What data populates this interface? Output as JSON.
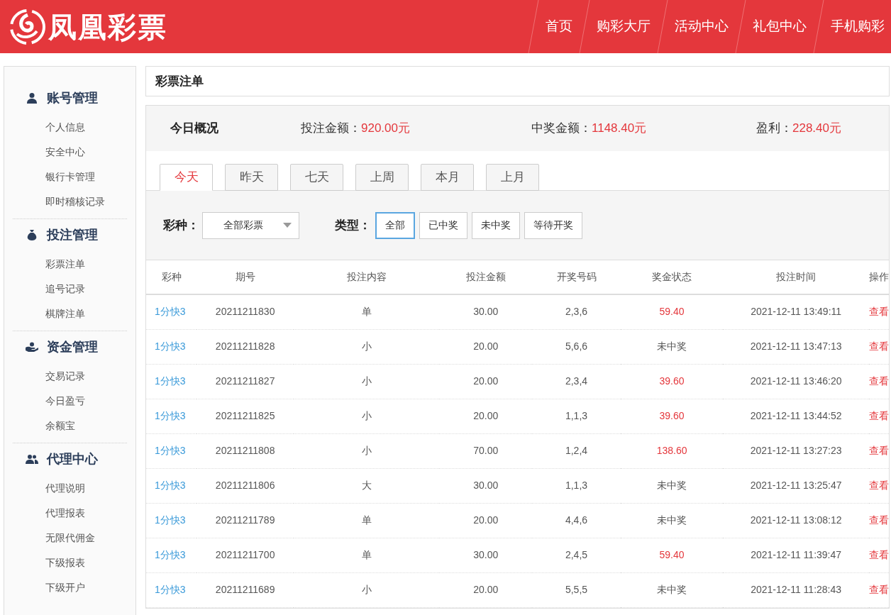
{
  "header": {
    "logo_text": "凤凰彩票",
    "nav": [
      "首页",
      "购彩大厅",
      "活动中心",
      "礼包中心",
      "手机购彩"
    ]
  },
  "sidebar": [
    {
      "title": "账号管理",
      "items": [
        "个人信息",
        "安全中心",
        "银行卡管理",
        "即时稽核记录"
      ]
    },
    {
      "title": "投注管理",
      "items": [
        "彩票注单",
        "追号记录",
        "棋牌注单"
      ]
    },
    {
      "title": "资金管理",
      "items": [
        "交易记录",
        "今日盈亏",
        "余额宝"
      ]
    },
    {
      "title": "代理中心",
      "items": [
        "代理说明",
        "代理报表",
        "无限代佣金",
        "下级报表",
        "下级开户"
      ]
    }
  ],
  "page_title": "彩票注单",
  "summary": {
    "title": "今日概况",
    "stats": [
      {
        "label": "投注金额：",
        "value": "920.00元"
      },
      {
        "label": "中奖金额：",
        "value": "1148.40元"
      },
      {
        "label": "盈利：",
        "value": "228.40元"
      }
    ]
  },
  "tabs": [
    {
      "label": "今天",
      "selected": true
    },
    {
      "label": "昨天",
      "selected": false
    },
    {
      "label": "七天",
      "selected": false
    },
    {
      "label": "上周",
      "selected": false
    },
    {
      "label": "本月",
      "selected": false
    },
    {
      "label": "上月",
      "selected": false
    }
  ],
  "filters": {
    "lottery_label": "彩种：",
    "lottery_value": "全部彩票",
    "type_label": "类型：",
    "types": [
      {
        "label": "全部",
        "selected": true
      },
      {
        "label": "已中奖",
        "selected": false
      },
      {
        "label": "未中奖",
        "selected": false
      },
      {
        "label": "等待开奖",
        "selected": false
      }
    ]
  },
  "table": {
    "columns": [
      "彩种",
      "期号",
      "投注内容",
      "投注金额",
      "开奖号码",
      "奖金状态",
      "投注时间",
      "操作"
    ],
    "rows": [
      {
        "game": "1分快3",
        "issue": "20211211830",
        "content": "单",
        "amount": "30.00",
        "numbers": "2,3,6",
        "status": "59.40",
        "won": true,
        "time": "2021-12-11 13:49:11",
        "action": "查看"
      },
      {
        "game": "1分快3",
        "issue": "20211211828",
        "content": "小",
        "amount": "20.00",
        "numbers": "5,6,6",
        "status": "未中奖",
        "won": false,
        "time": "2021-12-11 13:47:13",
        "action": "查看"
      },
      {
        "game": "1分快3",
        "issue": "20211211827",
        "content": "小",
        "amount": "20.00",
        "numbers": "2,3,4",
        "status": "39.60",
        "won": true,
        "time": "2021-12-11 13:46:20",
        "action": "查看"
      },
      {
        "game": "1分快3",
        "issue": "20211211825",
        "content": "小",
        "amount": "20.00",
        "numbers": "1,1,3",
        "status": "39.60",
        "won": true,
        "time": "2021-12-11 13:44:52",
        "action": "查看"
      },
      {
        "game": "1分快3",
        "issue": "20211211808",
        "content": "小",
        "amount": "70.00",
        "numbers": "1,2,4",
        "status": "138.60",
        "won": true,
        "time": "2021-12-11 13:27:23",
        "action": "查看"
      },
      {
        "game": "1分快3",
        "issue": "20211211806",
        "content": "大",
        "amount": "30.00",
        "numbers": "1,1,3",
        "status": "未中奖",
        "won": false,
        "time": "2021-12-11 13:25:47",
        "action": "查看"
      },
      {
        "game": "1分快3",
        "issue": "20211211789",
        "content": "单",
        "amount": "20.00",
        "numbers": "4,4,6",
        "status": "未中奖",
        "won": false,
        "time": "2021-12-11 13:08:12",
        "action": "查看"
      },
      {
        "game": "1分快3",
        "issue": "20211211700",
        "content": "单",
        "amount": "30.00",
        "numbers": "2,4,5",
        "status": "59.40",
        "won": true,
        "time": "2021-12-11 11:39:47",
        "action": "查看"
      },
      {
        "game": "1分快3",
        "issue": "20211211689",
        "content": "小",
        "amount": "20.00",
        "numbers": "5,5,5",
        "status": "未中奖",
        "won": false,
        "time": "2021-12-11 11:28:43",
        "action": "查看"
      }
    ]
  }
}
